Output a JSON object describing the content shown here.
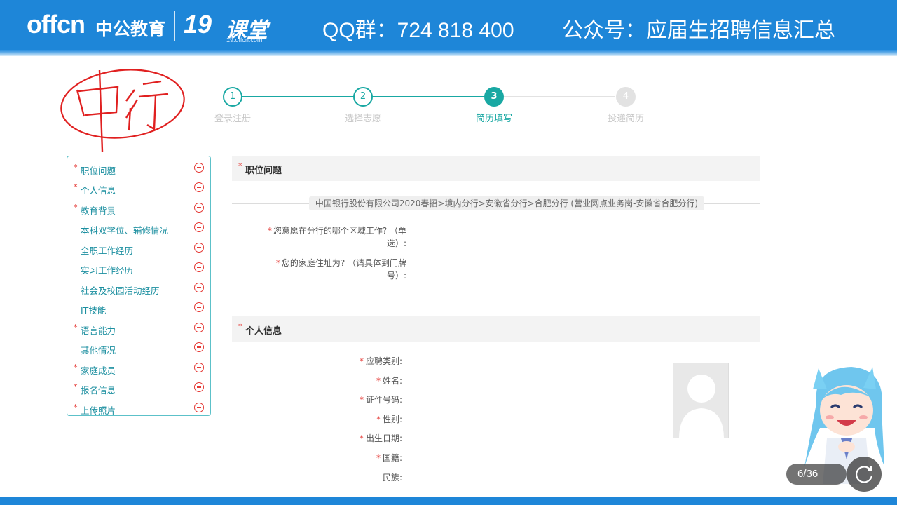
{
  "header": {
    "logo_offcn": "offcn",
    "logo_cn": "中公教育",
    "logo_19": "19",
    "logo_ketang": "课堂",
    "logo_sub": "19.offcn.com",
    "qq_group": "QQ群：724 818 400",
    "wechat": "公众号：应届生招聘信息汇总"
  },
  "steps": [
    {
      "num": "1",
      "label": "登录注册",
      "state": "done"
    },
    {
      "num": "2",
      "label": "选择志愿",
      "state": "done"
    },
    {
      "num": "3",
      "label": "简历填写",
      "state": "active"
    },
    {
      "num": "4",
      "label": "投递简历",
      "state": "todo"
    }
  ],
  "sidebar": {
    "items": [
      {
        "label": "职位问题",
        "required": true
      },
      {
        "label": "个人信息",
        "required": true
      },
      {
        "label": "教育背景",
        "required": true
      },
      {
        "label": "本科双学位、辅修情况",
        "required": false
      },
      {
        "label": "全职工作经历",
        "required": false
      },
      {
        "label": "实习工作经历",
        "required": false
      },
      {
        "label": "社会及校园活动经历",
        "required": false
      },
      {
        "label": "IT技能",
        "required": false
      },
      {
        "label": "语言能力",
        "required": true
      },
      {
        "label": "其他情况",
        "required": false
      },
      {
        "label": "家庭成员",
        "required": true
      },
      {
        "label": "报名信息",
        "required": true
      },
      {
        "label": "上传照片",
        "required": true
      }
    ]
  },
  "sections": {
    "position": {
      "title": "职位问题",
      "job_path": "中国银行股份有限公司2020春招>境内分行>安徽省分行>合肥分行 (营业网点业务岗-安徽省合肥分行)",
      "q1_line1": "您意愿在分行的哪个区域工作? （单",
      "q1_line2": "选）:",
      "q2_line1": "您的家庭住址为? （请具体到门牌",
      "q2_line2": "号）:"
    },
    "personal": {
      "title": "个人信息",
      "fields": [
        {
          "label": "应聘类别:",
          "required": true
        },
        {
          "label": "姓名:",
          "required": true
        },
        {
          "label": "证件号码:",
          "required": true
        },
        {
          "label": "性别:",
          "required": true
        },
        {
          "label": "出生日期:",
          "required": true
        },
        {
          "label": "国籍:",
          "required": true
        },
        {
          "label": "民族:",
          "required": false
        }
      ]
    }
  },
  "overlay": {
    "pager": "6/36",
    "annotation": "中行"
  },
  "colors": {
    "brand_blue": "#1e86d8",
    "teal": "#19a8a3",
    "required_red": "#e53935"
  },
  "icons": {
    "refresh": "refresh-icon",
    "remove": "minus-circle-icon",
    "avatar": "avatar-placeholder-icon"
  }
}
